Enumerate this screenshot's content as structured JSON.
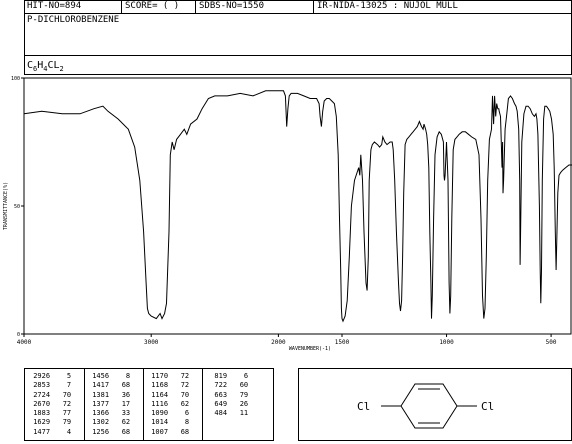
{
  "header": {
    "hit": "HIT-NO=894",
    "score": "SCORE=  (  )",
    "sdbs": "SDBS-NO=1550",
    "ir": "IR-NIDA-13025 : NUJOL MULL",
    "compound": "P-DICHLOROBENZENE",
    "formula_parts": [
      "C",
      "6",
      "H",
      "4",
      "CL",
      "2"
    ]
  },
  "chart_data": {
    "type": "line",
    "title": "",
    "xlabel": "WAVENUMBER(-1)",
    "ylabel": "TRANSMITTANCE(%)",
    "xlim": [
      4000,
      400
    ],
    "ylim": [
      0,
      100
    ],
    "x_ticks": [
      4000,
      3000,
      2000,
      1500,
      1000,
      500
    ],
    "x_tick_labels": [
      "4000",
      "3000",
      "2000",
      "1500",
      "1000",
      "500"
    ],
    "y_ticks": [
      0,
      50,
      100
    ],
    "y_tick_labels": [
      "0",
      "50",
      "100"
    ],
    "grid": false,
    "series": [
      {
        "points": [
          [
            4000,
            86
          ],
          [
            3860,
            87
          ],
          [
            3700,
            86
          ],
          [
            3560,
            86
          ],
          [
            3450,
            88
          ],
          [
            3380,
            89
          ],
          [
            3340,
            87
          ],
          [
            3260,
            84
          ],
          [
            3180,
            80
          ],
          [
            3130,
            73
          ],
          [
            3090,
            60
          ],
          [
            3060,
            40
          ],
          [
            3040,
            20
          ],
          [
            3030,
            10
          ],
          [
            3020,
            8
          ],
          [
            3000,
            7
          ],
          [
            2960,
            6
          ],
          [
            2930,
            8
          ],
          [
            2915,
            6
          ],
          [
            2895,
            8
          ],
          [
            2880,
            12
          ],
          [
            2860,
            40
          ],
          [
            2850,
            70
          ],
          [
            2835,
            75
          ],
          [
            2820,
            72
          ],
          [
            2800,
            76
          ],
          [
            2770,
            78
          ],
          [
            2740,
            80
          ],
          [
            2720,
            78
          ],
          [
            2690,
            82
          ],
          [
            2640,
            84
          ],
          [
            2600,
            88
          ],
          [
            2550,
            92
          ],
          [
            2500,
            93
          ],
          [
            2400,
            93
          ],
          [
            2300,
            94
          ],
          [
            2200,
            93
          ],
          [
            2100,
            95
          ],
          [
            2000,
            95
          ],
          [
            1960,
            95
          ],
          [
            1945,
            93
          ],
          [
            1935,
            81
          ],
          [
            1925,
            88
          ],
          [
            1915,
            93
          ],
          [
            1900,
            94
          ],
          [
            1850,
            94
          ],
          [
            1800,
            93
          ],
          [
            1750,
            92
          ],
          [
            1700,
            92
          ],
          [
            1680,
            90
          ],
          [
            1672,
            85
          ],
          [
            1662,
            81
          ],
          [
            1652,
            87
          ],
          [
            1640,
            91
          ],
          [
            1620,
            92
          ],
          [
            1600,
            92
          ],
          [
            1580,
            91
          ],
          [
            1560,
            90
          ],
          [
            1545,
            85
          ],
          [
            1530,
            70
          ],
          [
            1520,
            45
          ],
          [
            1510,
            25
          ],
          [
            1505,
            10
          ],
          [
            1500,
            6
          ],
          [
            1495,
            5
          ],
          [
            1485,
            7
          ],
          [
            1475,
            13
          ],
          [
            1465,
            30
          ],
          [
            1455,
            50
          ],
          [
            1440,
            60
          ],
          [
            1420,
            65
          ],
          [
            1415,
            62
          ],
          [
            1410,
            70
          ],
          [
            1402,
            60
          ],
          [
            1395,
            40
          ],
          [
            1390,
            30
          ],
          [
            1385,
            20
          ],
          [
            1380,
            17
          ],
          [
            1374,
            30
          ],
          [
            1370,
            60
          ],
          [
            1362,
            72
          ],
          [
            1355,
            74
          ],
          [
            1345,
            75
          ],
          [
            1330,
            74
          ],
          [
            1320,
            73
          ],
          [
            1310,
            74
          ],
          [
            1305,
            77
          ],
          [
            1295,
            75
          ],
          [
            1285,
            74
          ],
          [
            1270,
            75
          ],
          [
            1260,
            75
          ],
          [
            1255,
            72
          ],
          [
            1248,
            60
          ],
          [
            1240,
            40
          ],
          [
            1230,
            20
          ],
          [
            1225,
            12
          ],
          [
            1220,
            9
          ],
          [
            1215,
            13
          ],
          [
            1210,
            30
          ],
          [
            1205,
            55
          ],
          [
            1198,
            74
          ],
          [
            1190,
            76
          ],
          [
            1180,
            77
          ],
          [
            1170,
            78
          ],
          [
            1160,
            79
          ],
          [
            1150,
            80
          ],
          [
            1140,
            81
          ],
          [
            1130,
            83
          ],
          [
            1120,
            81
          ],
          [
            1112,
            80
          ],
          [
            1108,
            82
          ],
          [
            1100,
            80
          ],
          [
            1095,
            78
          ],
          [
            1090,
            74
          ],
          [
            1085,
            65
          ],
          [
            1080,
            40
          ],
          [
            1075,
            20
          ],
          [
            1072,
            6
          ],
          [
            1068,
            15
          ],
          [
            1062,
            45
          ],
          [
            1055,
            70
          ],
          [
            1045,
            77
          ],
          [
            1035,
            79
          ],
          [
            1025,
            78
          ],
          [
            1015,
            75
          ],
          [
            1012,
            62
          ],
          [
            1010,
            60
          ],
          [
            1007,
            62
          ],
          [
            1000,
            75
          ],
          [
            993,
            60
          ],
          [
            988,
            20
          ],
          [
            984,
            8
          ],
          [
            980,
            15
          ],
          [
            975,
            45
          ],
          [
            968,
            72
          ],
          [
            960,
            76
          ],
          [
            950,
            77
          ],
          [
            940,
            78
          ],
          [
            925,
            79
          ],
          [
            910,
            79
          ],
          [
            895,
            78
          ],
          [
            880,
            77
          ],
          [
            860,
            76
          ],
          [
            845,
            70
          ],
          [
            835,
            45
          ],
          [
            828,
            15
          ],
          [
            822,
            6
          ],
          [
            816,
            10
          ],
          [
            810,
            30
          ],
          [
            803,
            60
          ],
          [
            795,
            76
          ],
          [
            785,
            80
          ],
          [
            775,
            82
          ],
          [
            765,
            85
          ],
          [
            755,
            88
          ],
          [
            748,
            87
          ],
          [
            740,
            80
          ],
          [
            735,
            65
          ],
          [
            730,
            55
          ],
          [
            727,
            60
          ],
          [
            732,
            75
          ],
          [
            742,
            85
          ],
          [
            750,
            88
          ],
          [
            760,
            90
          ],
          [
            770,
            93
          ],
          [
            780,
            93
          ],
          [
            720,
            80
          ],
          [
            712,
            86
          ],
          [
            704,
            92
          ],
          [
            694,
            93
          ],
          [
            685,
            92
          ],
          [
            675,
            90
          ],
          [
            668,
            89
          ],
          [
            662,
            87
          ],
          [
            655,
            80
          ],
          [
            650,
            60
          ],
          [
            648,
            27
          ],
          [
            646,
            40
          ],
          [
            640,
            75
          ],
          [
            630,
            86
          ],
          [
            620,
            89
          ],
          [
            610,
            89
          ],
          [
            600,
            88
          ],
          [
            590,
            86
          ],
          [
            580,
            85
          ],
          [
            572,
            86
          ],
          [
            568,
            84
          ],
          [
            563,
            78
          ],
          [
            556,
            50
          ],
          [
            552,
            25
          ],
          [
            549,
            12
          ],
          [
            546,
            25
          ],
          [
            542,
            60
          ],
          [
            536,
            84
          ],
          [
            530,
            89
          ],
          [
            522,
            89
          ],
          [
            514,
            88
          ],
          [
            506,
            87
          ],
          [
            498,
            84
          ],
          [
            490,
            78
          ],
          [
            485,
            65
          ],
          [
            480,
            40
          ],
          [
            476,
            25
          ],
          [
            473,
            35
          ],
          [
            468,
            55
          ],
          [
            462,
            62
          ],
          [
            455,
            63
          ],
          [
            445,
            64
          ],
          [
            430,
            65
          ],
          [
            415,
            66
          ],
          [
            400,
            66
          ]
        ]
      }
    ]
  },
  "peak_table": {
    "columns": [
      [
        [
          "2926",
          "5"
        ],
        [
          "2853",
          "7"
        ],
        [
          "2724",
          "70"
        ],
        [
          "2670",
          "72"
        ],
        [
          "1883",
          "77"
        ],
        [
          "1629",
          "79"
        ],
        [
          "1477",
          "4"
        ]
      ],
      [
        [
          "1456",
          "8"
        ],
        [
          "1417",
          "68"
        ],
        [
          "1381",
          "36"
        ],
        [
          "1377",
          "17"
        ],
        [
          "1366",
          "33"
        ],
        [
          "1302",
          "62"
        ],
        [
          "1256",
          "68"
        ]
      ],
      [
        [
          "1170",
          "72"
        ],
        [
          "1168",
          "72"
        ],
        [
          "1164",
          "70"
        ],
        [
          "1116",
          "62"
        ],
        [
          "1090",
          "6"
        ],
        [
          "1014",
          "8"
        ],
        [
          "1007",
          "68"
        ]
      ],
      [
        [
          "819",
          "6"
        ],
        [
          "722",
          "60"
        ],
        [
          "663",
          "79"
        ],
        [
          "649",
          "26"
        ],
        [
          "484",
          "11"
        ]
      ]
    ]
  },
  "structure": {
    "left_label": "Cl",
    "right_label": "Cl"
  }
}
